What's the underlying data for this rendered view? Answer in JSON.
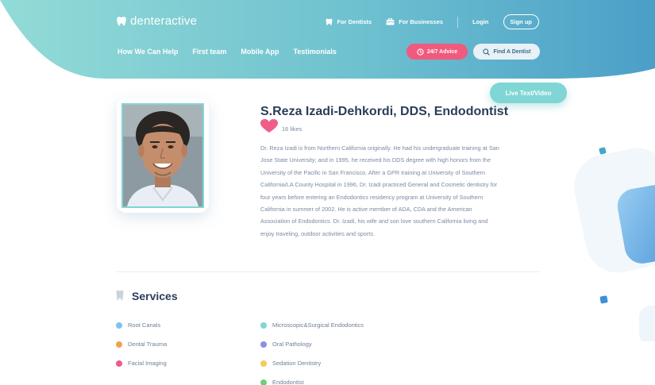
{
  "brand": {
    "name": "denteractive"
  },
  "top_links": {
    "for_dentists": "For Dentists",
    "for_businesses": "For Businesses",
    "login": "Login",
    "signup": "Sign up"
  },
  "nav": [
    "How We Can Help",
    "First team",
    "Mobile App",
    "Testimonials"
  ],
  "buttons": {
    "advice": "24/7 Advice",
    "find": "Find A Dentist",
    "live": "Live Text/Video"
  },
  "profile": {
    "name": "S.Reza Izadi-Dehkordi, DDS, Endodontist",
    "likes": "16 likes",
    "bio_lines": [
      "Dr. Reza Izadi is from Northern California originally. He had his undergraduate training at San",
      "Jose State University; and in 1995, he received his DDS degree with high honors from the",
      "University of the Pacific in San Francisco. After a GPR training at University of Southern",
      "California/LA County Hospital in 1996, Dr. Izadi practiced General and Cosmetic dentistry for",
      "four years before entering an Endodontics residency program at University of Southern",
      "California in summer of 2002. He is active member of ADA, CDA and the American",
      "Association of Endodontics. Dr. Izadi, his wife and son love southern California living and",
      "enjoy traveling, outdoor activities and sports."
    ]
  },
  "services": {
    "title": "Services",
    "col1": [
      {
        "label": "Root Canals",
        "color": "#7cc4ec"
      },
      {
        "label": "Dental Trauma",
        "color": "#f3a24a"
      },
      {
        "label": "Facial Imaging",
        "color": "#ef5b86"
      }
    ],
    "col2": [
      {
        "label": "Microscopic&Surgical Endodontics",
        "color": "#7fd6d4"
      },
      {
        "label": "Oral Pathology",
        "color": "#8a8fe8"
      },
      {
        "label": "Sedation Dentistry",
        "color": "#f2cb5a"
      },
      {
        "label": "Endodontist",
        "color": "#6ccf7c"
      }
    ]
  },
  "colors": {
    "header_start": "#8ed8d6",
    "header_end": "#4ba3c9",
    "accent_pink": "#f05a7e",
    "accent_teal": "#7fd6d4"
  }
}
